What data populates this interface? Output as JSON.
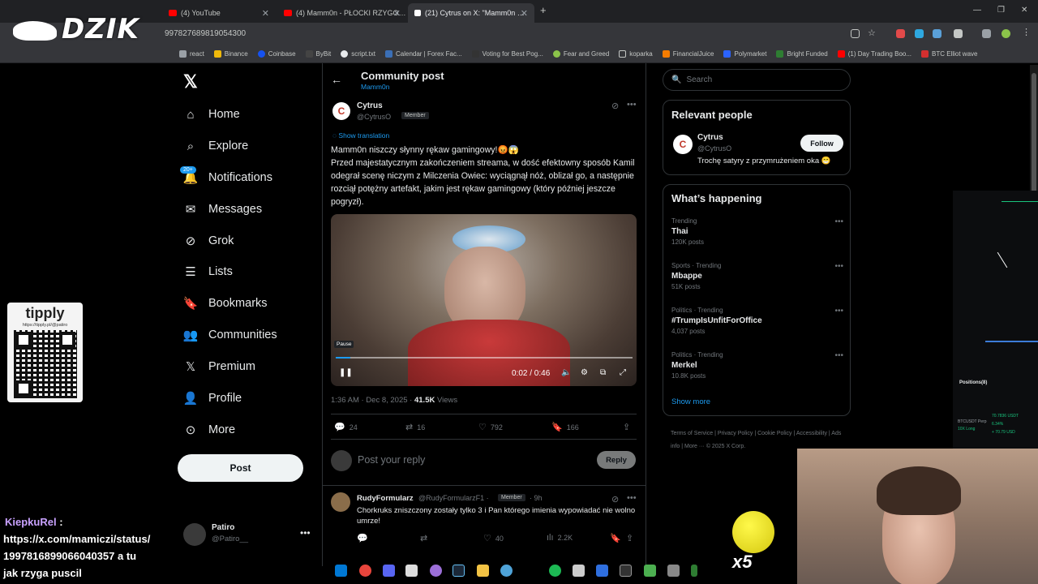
{
  "browser": {
    "tabs": [
      {
        "label": "(4) YouTube",
        "color": "#ff0000"
      },
      {
        "label": "(4) Mamm0n - PŁOCKI RZYGO…",
        "color": "#ff0000"
      },
      {
        "label": "(21) Cytrus on X: \"Mamm0n …",
        "color": "#ffffff"
      }
    ],
    "url": "997827689819054300",
    "bookmarks": [
      "react",
      "Binance",
      "Coinbase",
      "ByBit",
      "script.txt",
      "Calendar | Forex Fac...",
      "Voting for Best Pog...",
      "Fear and Greed",
      "koparka",
      "FinancialJuice",
      "Polymarket",
      "Bright Funded",
      "(1) Day Trading Boo...",
      "BTC Elliot wave"
    ]
  },
  "overlay": {
    "logo": "DZIK",
    "tippy_title": "tipply",
    "tippy_url": "https://tipply.pl/@patiro",
    "chat_user": "KiepkuRel",
    "chat_colon": ":",
    "chat_lines": [
      "https://x.com/mamiczi/status/",
      "1997816899066040357 a tu",
      "jak rzyga puscil"
    ],
    "x5": "x5"
  },
  "nav": {
    "items": [
      {
        "label": "Home",
        "icon": "home-icon"
      },
      {
        "label": "Explore",
        "icon": "search-icon"
      },
      {
        "label": "Notifications",
        "icon": "bell-icon"
      },
      {
        "label": "Messages",
        "icon": "mail-icon"
      },
      {
        "label": "Grok",
        "icon": "grok-icon"
      },
      {
        "label": "Lists",
        "icon": "list-icon"
      },
      {
        "label": "Bookmarks",
        "icon": "bookmark-icon"
      },
      {
        "label": "Communities",
        "icon": "people-icon"
      },
      {
        "label": "Premium",
        "icon": "x-icon"
      },
      {
        "label": "Profile",
        "icon": "user-icon"
      },
      {
        "label": "More",
        "icon": "more-circle-icon"
      }
    ],
    "notif_badge": "20+",
    "post_label": "Post",
    "account": {
      "name": "Patiro",
      "handle": "@Patiro__"
    }
  },
  "main": {
    "title": "Community post",
    "subtitle": "Mamm0n",
    "author": {
      "name": "Cytrus",
      "handle": "@CytrusO",
      "tag": "Member"
    },
    "show_translation": "Show translation",
    "text_line1": "Mamm0n niszczy słynny rękaw gamingowy!😡😱",
    "text_body": "Przed majestatycznym zakończeniem streama, w dość efektowny sposób Kamil odegrał scenę niczym z Milczenia Owiec: wyciągnął nóż, oblizał go, a następnie rozciął potężny artefakt, jakim jest rękaw gamingowy (który później jeszcze pogryzł).",
    "video": {
      "tooltip": "Pause",
      "time": "0:02 / 0:46",
      "progress": 0.05
    },
    "meta": {
      "time": "1:36 AM · Dec 8, 2025 · ",
      "views": "41.5K",
      "views_label": " Views"
    },
    "actions": {
      "replies": "24",
      "reposts": "16",
      "likes": "792",
      "bookmarks": "166"
    },
    "reply_placeholder": "Post your reply",
    "reply_button": "Reply",
    "comment": {
      "name": "RudyFormularz",
      "handle": "@RudyFormularzF1 ·",
      "tag": "Member",
      "time": "· 9h",
      "text": "Chorkruks zniszczony zostały tylko 3 i Pan którego imienia wypowiadać nie wolno umrze!",
      "replies": "",
      "likes": "40",
      "views": "2.2K"
    }
  },
  "right": {
    "search_placeholder": "Search",
    "relevant_title": "Relevant people",
    "person": {
      "name": "Cytrus",
      "handle": "@CytrusO",
      "bio": "Trochę satyry z przymrużeniem oka 😁",
      "follow": "Follow"
    },
    "happening_title": "What’s happening",
    "trends": [
      {
        "context": "Trending",
        "name": "Thai",
        "posts": "120K posts"
      },
      {
        "context": "Sports · Trending",
        "name": "Mbappe",
        "posts": "51K posts"
      },
      {
        "context": "Politics · Trending",
        "name": "#TrumpIsUnfitForOffice",
        "posts": "4,037 posts"
      },
      {
        "context": "Politics · Trending",
        "name": "Merkel",
        "posts": "10.8K posts"
      }
    ],
    "show_more": "Show more",
    "footer": "Terms of Service  |  Privacy Policy  |  Cookie Policy  |  Accessibility  |  Ads info  |  More ···  © 2025 X Corp."
  },
  "trading": {
    "positions": "Positions(8)",
    "pair": "BTCUSDT",
    "mode": "Perp",
    "side": "10X Long",
    "pnl1": "70.7836 USDT",
    "pnl2": "6.34%",
    "pnl3": "+ 70.79 USD"
  }
}
